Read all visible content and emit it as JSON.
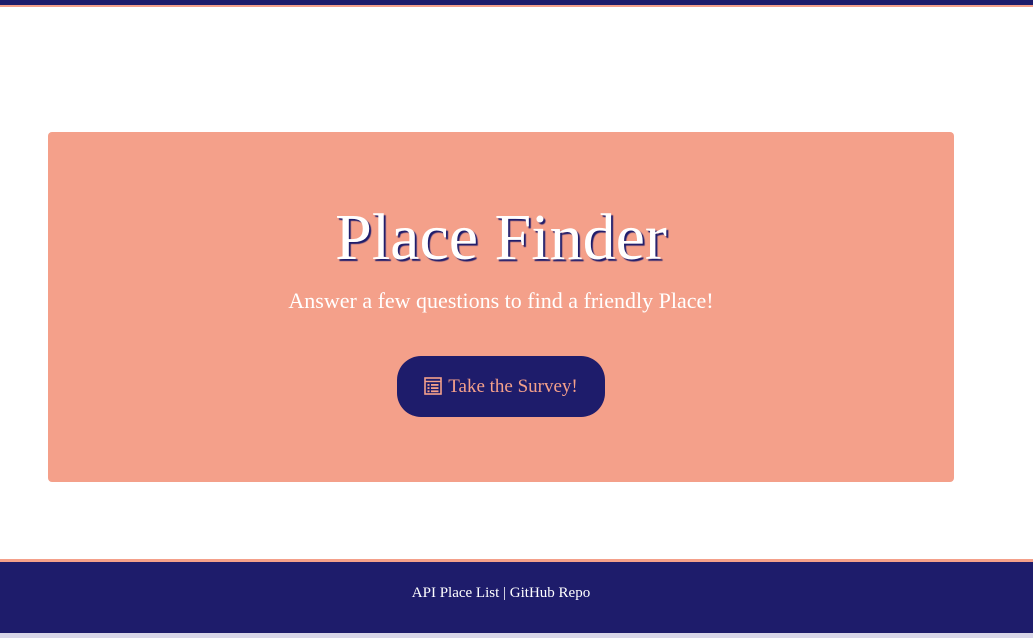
{
  "hero": {
    "title": "Place Finder",
    "subtitle": "Answer a few questions to find a friendly Place!",
    "survey_button": {
      "icon": "list-alt-icon",
      "label": "Take the Survey!"
    }
  },
  "footer": {
    "links": [
      {
        "label": "API Place List"
      },
      {
        "label": "GitHub Repo"
      }
    ],
    "separator": "|"
  },
  "colors": {
    "navy": "#1e1c6b",
    "salmon": "#f4a08a",
    "white": "#ffffff"
  }
}
